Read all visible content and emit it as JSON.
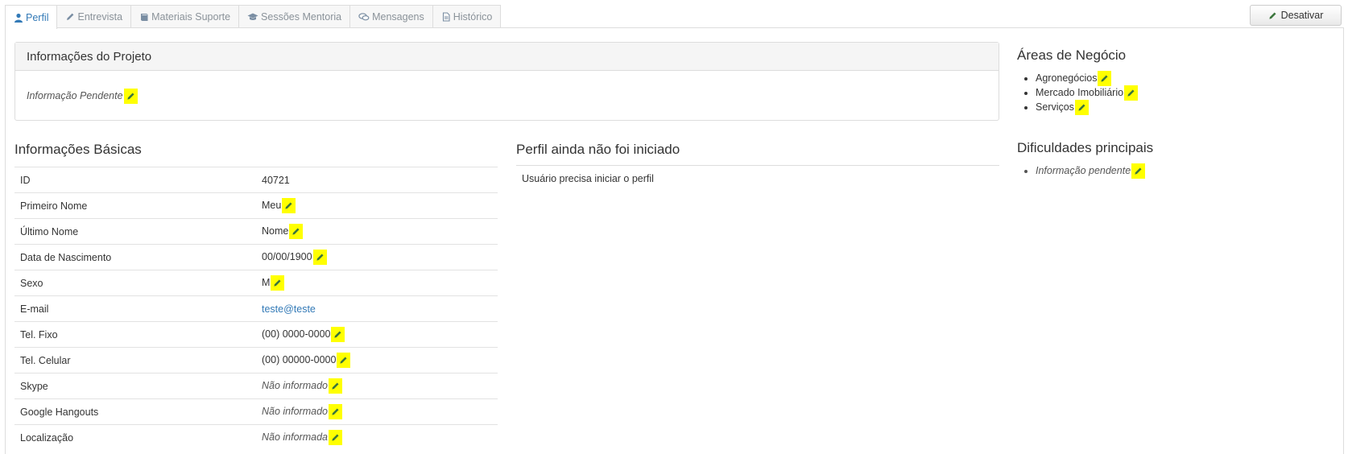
{
  "tabs": [
    {
      "label": "Perfil",
      "icon": "user-icon",
      "active": true
    },
    {
      "label": "Entrevista",
      "icon": "pencil-icon",
      "active": false
    },
    {
      "label": "Materiais Suporte",
      "icon": "book-icon",
      "active": false
    },
    {
      "label": "Sessões Mentoria",
      "icon": "graduation-cap-icon",
      "active": false
    },
    {
      "label": "Mensagens",
      "icon": "comments-icon",
      "active": false
    },
    {
      "label": "Histórico",
      "icon": "file-icon",
      "active": false
    }
  ],
  "deactivate_label": "Desativar",
  "project": {
    "title": "Informações do Projeto",
    "value": "Informação Pendente"
  },
  "basic": {
    "title": "Informações Básicas",
    "rows": [
      {
        "label": "ID",
        "value": "40721"
      },
      {
        "label": "Primeiro Nome",
        "value": "Meu"
      },
      {
        "label": "Último Nome",
        "value": "Nome"
      },
      {
        "label": "Data de Nascimento",
        "value": "00/00/1900"
      },
      {
        "label": "Sexo",
        "value": "M"
      },
      {
        "label": "E-mail",
        "value": "teste@teste"
      },
      {
        "label": "Tel. Fixo",
        "value": "(00) 0000-0000"
      },
      {
        "label": "Tel. Celular",
        "value": "(00) 00000-0000"
      },
      {
        "label": "Skype",
        "value": "Não informado"
      },
      {
        "label": "Google Hangouts",
        "value": "Não informado"
      },
      {
        "label": "Localização",
        "value": "Não informada"
      }
    ]
  },
  "profile": {
    "title": "Perfil ainda não foi iniciado",
    "message": "Usuário precisa iniciar o perfil"
  },
  "business_areas": {
    "title": "Áreas de Negócio",
    "items": [
      "Agronegócios",
      "Mercado Imobiliário",
      "Serviços"
    ]
  },
  "difficulties": {
    "title": "Dificuldades principais",
    "items": [
      "Informação pendente"
    ]
  },
  "colors": {
    "highlight": "#ffff00",
    "pencil": "#3c763d",
    "link": "#337ab7",
    "active_tab": "#337ab7"
  }
}
